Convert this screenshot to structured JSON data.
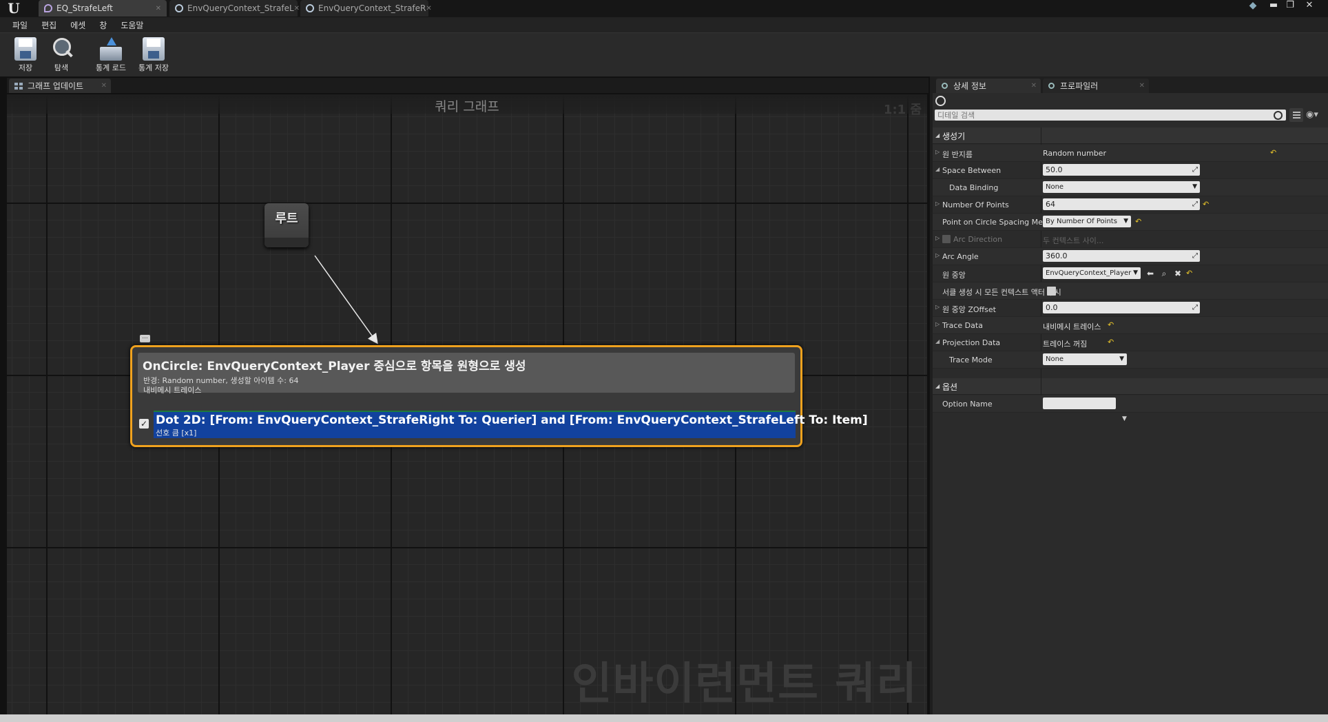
{
  "window": {
    "tabs": [
      {
        "label": "EQ_StrafeLeft"
      },
      {
        "label": "EnvQueryContext_StrafeL"
      },
      {
        "label": "EnvQueryContext_StrafeR"
      }
    ]
  },
  "menu": [
    "파일",
    "편집",
    "에셋",
    "창",
    "도움말"
  ],
  "toolbar": {
    "save": "저장",
    "browse": "탐색",
    "load_stats": "통계 로드",
    "save_stats": "통계 저장"
  },
  "graph": {
    "tab_label": "그래프 업데이트",
    "title": "쿼리 그래프",
    "zoom": "1:1 줌",
    "watermark": "인바이런먼트 쿼리",
    "root_label": "루트",
    "comment_bubble": "...",
    "generator": {
      "title": "OnCircle: EnvQueryContext_Player 중심으로 항목을 원형으로 생성",
      "detail1": "반경: Random number, 생성할 아이템 수: 64",
      "detail2": "내비메시 트레이스"
    },
    "test": {
      "enabled": true,
      "title": "Dot 2D: [From: EnvQueryContext_StrafeRight To: Querier] and [From: EnvQueryContext_StrafeLeft To: Item]",
      "subtitle": "선호 큼 [x1]"
    }
  },
  "details": {
    "tab_details": "상세 정보",
    "tab_profiler": "프로파일러",
    "search_placeholder": "디테일 검색",
    "generator_category": "생성기",
    "option_category": "옵션",
    "props": {
      "circle_radius": {
        "label": "원 반지름",
        "value": "Random number"
      },
      "space_between": {
        "label": "Space Between",
        "value": "50.0"
      },
      "data_binding": {
        "label": "Data Binding",
        "value": "None"
      },
      "number_of_points": {
        "label": "Number Of Points",
        "value": "64"
      },
      "spacing_method": {
        "label": "Point on Circle Spacing Method",
        "value": "By Number Of Points"
      },
      "arc_direction": {
        "label": "Arc Direction",
        "value": "두 컨텍스트 사이..."
      },
      "arc_angle": {
        "label": "Arc Angle",
        "value": "360.0"
      },
      "circle_center": {
        "label": "원 중앙",
        "value": "EnvQueryContext_Player"
      },
      "ignore_context_actors": {
        "label": "서클 생성 시 모든 컨텍스트 액터 무시"
      },
      "center_zoffset": {
        "label": "원 중앙 ZOffset",
        "value": "0.0"
      },
      "trace_data": {
        "label": "Trace Data",
        "value": "내비메시 트레이스"
      },
      "projection_data": {
        "label": "Projection Data",
        "value": "트레이스 꺼짐"
      },
      "trace_mode": {
        "label": "Trace Mode",
        "value": "None"
      },
      "option_name": {
        "label": "Option Name",
        "value": ""
      }
    }
  },
  "colors": {
    "node_border": "#f0a21e",
    "test_block": "#12429e",
    "reset_arrow": "#e8c42a"
  }
}
